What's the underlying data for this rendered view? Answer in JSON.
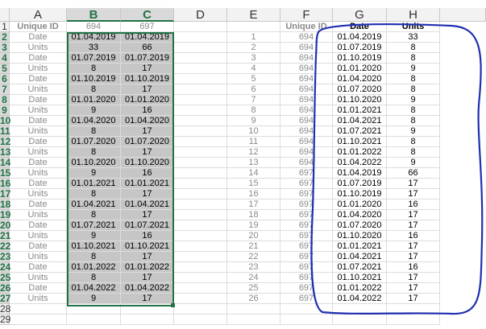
{
  "columns": [
    "A",
    "B",
    "C",
    "D",
    "E",
    "F",
    "G",
    "H"
  ],
  "selected_columns": [
    "B",
    "C"
  ],
  "row_numbers": [
    "1",
    "2",
    "3",
    "4",
    "5",
    "6",
    "7",
    "8",
    "9",
    "10",
    "11",
    "12",
    "13",
    "14",
    "15",
    "16",
    "17",
    "18",
    "19",
    "20",
    "21",
    "22",
    "23",
    "24",
    "25",
    "26",
    "27",
    "28",
    "29"
  ],
  "header_row": {
    "A": "Unique ID",
    "B": "694",
    "C": "697",
    "F": "Unique ID",
    "G": "Date",
    "H": "Units"
  },
  "left_table": [
    {
      "label": "Date",
      "b": "01.04.2019",
      "c": "01.04.2019"
    },
    {
      "label": "Units",
      "b": "33",
      "c": "66"
    },
    {
      "label": "Date",
      "b": "01.07.2019",
      "c": "01.07.2019"
    },
    {
      "label": "Units",
      "b": "8",
      "c": "17"
    },
    {
      "label": "Date",
      "b": "01.10.2019",
      "c": "01.10.2019"
    },
    {
      "label": "Units",
      "b": "8",
      "c": "17"
    },
    {
      "label": "Date",
      "b": "01.01.2020",
      "c": "01.01.2020"
    },
    {
      "label": "Units",
      "b": "9",
      "c": "16"
    },
    {
      "label": "Date",
      "b": "01.04.2020",
      "c": "01.04.2020"
    },
    {
      "label": "Units",
      "b": "8",
      "c": "17"
    },
    {
      "label": "Date",
      "b": "01.07.2020",
      "c": "01.07.2020"
    },
    {
      "label": "Units",
      "b": "8",
      "c": "17"
    },
    {
      "label": "Date",
      "b": "01.10.2020",
      "c": "01.10.2020"
    },
    {
      "label": "Units",
      "b": "9",
      "c": "16"
    },
    {
      "label": "Date",
      "b": "01.01.2021",
      "c": "01.01.2021"
    },
    {
      "label": "Units",
      "b": "8",
      "c": "17"
    },
    {
      "label": "Date",
      "b": "01.04.2021",
      "c": "01.04.2021"
    },
    {
      "label": "Units",
      "b": "8",
      "c": "17"
    },
    {
      "label": "Date",
      "b": "01.07.2021",
      "c": "01.07.2021"
    },
    {
      "label": "Units",
      "b": "9",
      "c": "16"
    },
    {
      "label": "Date",
      "b": "01.10.2021",
      "c": "01.10.2021"
    },
    {
      "label": "Units",
      "b": "8",
      "c": "17"
    },
    {
      "label": "Date",
      "b": "01.01.2022",
      "c": "01.01.2022"
    },
    {
      "label": "Units",
      "b": "8",
      "c": "17"
    },
    {
      "label": "Date",
      "b": "01.04.2022",
      "c": "01.04.2022"
    },
    {
      "label": "Units",
      "b": "9",
      "c": "17"
    }
  ],
  "right_table": [
    {
      "e": "1",
      "f": "694",
      "g": "01.04.2019",
      "h": "33"
    },
    {
      "e": "2",
      "f": "694",
      "g": "01.07.2019",
      "h": "8"
    },
    {
      "e": "3",
      "f": "694",
      "g": "01.10.2019",
      "h": "8"
    },
    {
      "e": "4",
      "f": "694",
      "g": "01.01.2020",
      "h": "9"
    },
    {
      "e": "5",
      "f": "694",
      "g": "01.04.2020",
      "h": "8"
    },
    {
      "e": "6",
      "f": "694",
      "g": "01.07.2020",
      "h": "8"
    },
    {
      "e": "7",
      "f": "694",
      "g": "01.10.2020",
      "h": "9"
    },
    {
      "e": "8",
      "f": "694",
      "g": "01.01.2021",
      "h": "8"
    },
    {
      "e": "9",
      "f": "694",
      "g": "01.04.2021",
      "h": "8"
    },
    {
      "e": "10",
      "f": "694",
      "g": "01.07.2021",
      "h": "9"
    },
    {
      "e": "11",
      "f": "694",
      "g": "01.10.2021",
      "h": "8"
    },
    {
      "e": "12",
      "f": "694",
      "g": "01.01.2022",
      "h": "8"
    },
    {
      "e": "13",
      "f": "694",
      "g": "01.04.2022",
      "h": "9"
    },
    {
      "e": "14",
      "f": "697",
      "g": "01.04.2019",
      "h": "66"
    },
    {
      "e": "15",
      "f": "697",
      "g": "01.07.2019",
      "h": "17"
    },
    {
      "e": "16",
      "f": "697",
      "g": "01.10.2019",
      "h": "17"
    },
    {
      "e": "17",
      "f": "697",
      "g": "01.01.2020",
      "h": "16"
    },
    {
      "e": "18",
      "f": "697",
      "g": "01.04.2020",
      "h": "17"
    },
    {
      "e": "19",
      "f": "697",
      "g": "01.07.2020",
      "h": "17"
    },
    {
      "e": "20",
      "f": "697",
      "g": "01.10.2020",
      "h": "16"
    },
    {
      "e": "21",
      "f": "697",
      "g": "01.01.2021",
      "h": "17"
    },
    {
      "e": "22",
      "f": "697",
      "g": "01.04.2021",
      "h": "17"
    },
    {
      "e": "23",
      "f": "697",
      "g": "01.07.2021",
      "h": "16"
    },
    {
      "e": "24",
      "f": "697",
      "g": "01.10.2021",
      "h": "17"
    },
    {
      "e": "25",
      "f": "697",
      "g": "01.01.2022",
      "h": "17"
    },
    {
      "e": "26",
      "f": "697",
      "g": "01.04.2022",
      "h": "17"
    }
  ],
  "colors": {
    "selection_border": "#217346",
    "selection_fill": "#c6c6c6",
    "annotation": "#1f2fb0",
    "muted_text": "#8a8a8a"
  }
}
